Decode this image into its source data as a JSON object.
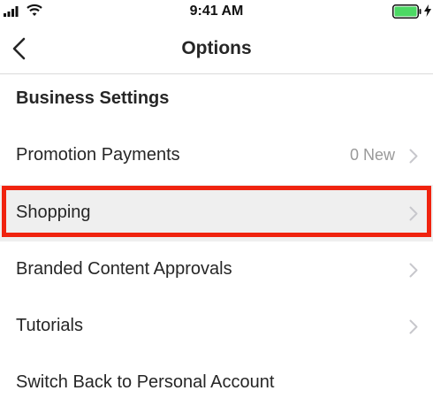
{
  "status_bar": {
    "time": "9:41 AM",
    "signal_icon": "cellular-signal-icon",
    "wifi_icon": "wifi-icon",
    "battery_icon": "battery-charging-icon",
    "battery_color": "#4cd964"
  },
  "nav": {
    "title": "Options",
    "back_icon": "chevron-left-icon"
  },
  "section": {
    "header": "Business Settings"
  },
  "rows": [
    {
      "label": "Promotion Payments",
      "value": "0 New",
      "chevron": true
    },
    {
      "label": "Shopping",
      "value": "",
      "chevron": true,
      "highlighted": true
    },
    {
      "label": "Branded Content Approvals",
      "value": "",
      "chevron": true
    },
    {
      "label": "Tutorials",
      "value": "",
      "chevron": true
    },
    {
      "label": "Switch Back to Personal Account",
      "value": "",
      "chevron": false
    }
  ],
  "colors": {
    "highlight_border": "#f0230f",
    "highlight_fill": "#efefef",
    "secondary_text": "#999999",
    "chevron": "#c7c7cc"
  }
}
